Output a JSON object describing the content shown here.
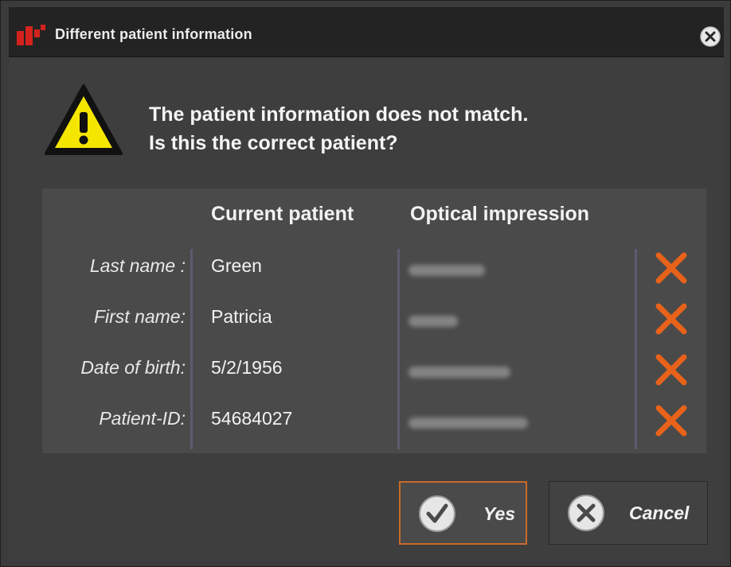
{
  "window": {
    "title": "Different patient information",
    "logo_icon": "app-logo-icon",
    "close_icon": "close-circle-icon"
  },
  "message": {
    "icon": "warning-triangle-icon",
    "line1": "The patient information does not match.",
    "line2": "Is this the correct patient?"
  },
  "table": {
    "headers": {
      "current": "Current patient",
      "optical": "Optical impression"
    },
    "rows": [
      {
        "label": "Last name :",
        "current": "Green",
        "optical_blurred": true,
        "mismatch_icon": "x-mismatch-icon"
      },
      {
        "label": "First name:",
        "current": "Patricia",
        "optical_blurred": true,
        "mismatch_icon": "x-mismatch-icon"
      },
      {
        "label": "Date of birth:",
        "current": "5/2/1956",
        "optical_blurred": true,
        "mismatch_icon": "x-mismatch-icon"
      },
      {
        "label": "Patient-ID:",
        "current": "54684027",
        "optical_blurred": true,
        "mismatch_icon": "x-mismatch-icon"
      }
    ]
  },
  "buttons": {
    "yes": {
      "label": "Yes",
      "icon": "check-circle-icon"
    },
    "cancel": {
      "label": "Cancel",
      "icon": "x-circle-icon"
    }
  },
  "colors": {
    "accent_orange": "#e8621a",
    "warning_yellow": "#f5e600",
    "focus_border": "#c86a2a"
  }
}
